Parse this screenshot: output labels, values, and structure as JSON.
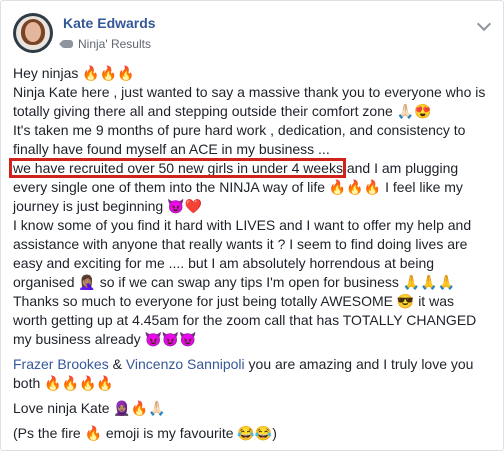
{
  "post": {
    "author": "Kate Edwards",
    "group": "Ninja' Results",
    "lines": [
      "Hey ninjas 🔥🔥🔥",
      "Ninja Kate here , just wanted to say a massive thank you to everyone who is",
      "totally giving there all and stepping outside their comfort zone 🙏🏻😍",
      "It's taken me 9 months of pure hard work , dedication, and consistency to",
      "finally have found myself an ACE in my business ..."
    ],
    "highlighted": "we have recruited over 50 new girls in under 4 weeks",
    "highlight_tail": " and I am plugging",
    "lines2": [
      "every single one of them into the NINJA way of life 🔥🔥🔥 I feel like my",
      "journey is just beginning 😈❤️",
      "I know some of you find it hard with LIVES and I want to offer my help and",
      "assistance with anyone that really wants it ? I seem to find doing lives are",
      "easy and exciting for me .... but I am absolutely horrendous at being",
      "organised 🤦🏽‍♀️ so if we can swap any tips I'm open for business 🙏🙏🙏",
      "Thanks so much to everyone for just being totally AWESOME 😎 it was",
      "worth getting up at 4.45am for the zoom call that has TOTALLY CHANGED",
      "my business already 😈😈😈"
    ],
    "mention1": "Frazer Brookes",
    "amp": " & ",
    "mention2": "Vincenzo Sannipoli",
    "mention_tail": " you are amazing and I truly love you",
    "mention_line2": "both 🔥🔥🔥🔥",
    "signoff": "Love ninja Kate 🧕🏽🔥🙏🏻",
    "ps": "(Ps the fire 🔥 emoji is my favourite 😂😂)"
  },
  "colors": {
    "highlight_box": "#d0231b",
    "link": "#365899"
  },
  "icons": [
    "avatar",
    "tag-icon",
    "chevron-down-icon"
  ]
}
